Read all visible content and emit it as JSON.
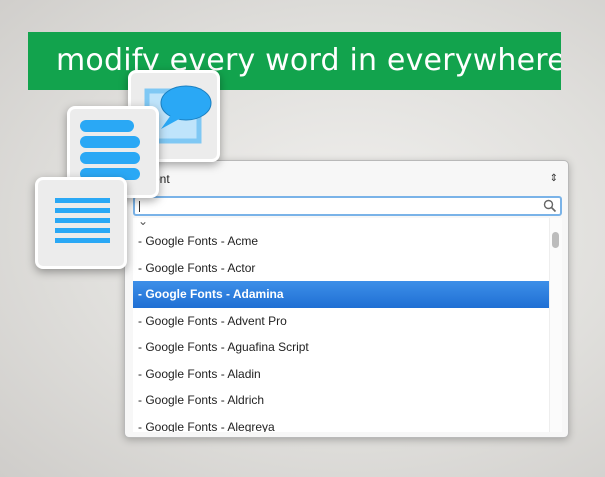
{
  "banner": {
    "text": "modify every word in everywhere"
  },
  "font_picker": {
    "select_label": "t Font",
    "select_arrows": "⇕",
    "search_value": "",
    "options": [
      {
        "label": "- Google Fonts - Acme",
        "selected": false
      },
      {
        "label": "- Google Fonts - Actor",
        "selected": false
      },
      {
        "label": "- Google Fonts - Adamina",
        "selected": true
      },
      {
        "label": "- Google Fonts - Advent Pro",
        "selected": false
      },
      {
        "label": "- Google Fonts - Aguafina Script",
        "selected": false
      },
      {
        "label": "- Google Fonts - Aladin",
        "selected": false
      },
      {
        "label": "- Google Fonts - Aldrich",
        "selected": false
      },
      {
        "label": "- Google Fonts - Alegreya",
        "selected": false
      }
    ]
  },
  "icons": {
    "back": "speech-bubble-icon",
    "middle": "stacked-bars-icon",
    "front": "lines-list-icon"
  },
  "colors": {
    "banner_green": "#12a34d",
    "icon_blue": "#2aa8f5",
    "selection_blue": "#2f7fe0"
  }
}
